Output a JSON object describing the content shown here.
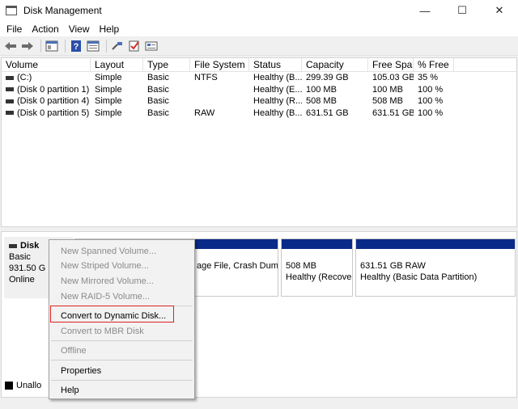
{
  "window": {
    "title": "Disk Management"
  },
  "window_buttons": {
    "minimize": "—",
    "maximize": "☐",
    "close": "✕"
  },
  "menubar": [
    "File",
    "Action",
    "View",
    "Help"
  ],
  "toolbar_icons": [
    "back-icon",
    "forward-icon",
    "show-hide-pane-icon",
    "help-icon",
    "properties-icon",
    "connect-icon",
    "check-icon",
    "settings-icon"
  ],
  "volumes": {
    "columns": [
      "Volume",
      "Layout",
      "Type",
      "File System",
      "Status",
      "Capacity",
      "Free Spa...",
      "% Free"
    ],
    "rows": [
      [
        "(C:)",
        "Simple",
        "Basic",
        "NTFS",
        "Healthy (B...",
        "299.39 GB",
        "105.03 GB",
        "35 %"
      ],
      [
        "(Disk 0 partition 1)",
        "Simple",
        "Basic",
        "",
        "Healthy (E...",
        "100 MB",
        "100 MB",
        "100 %"
      ],
      [
        "(Disk 0 partition 4)",
        "Simple",
        "Basic",
        "",
        "Healthy (R...",
        "508 MB",
        "508 MB",
        "100 %"
      ],
      [
        "(Disk 0 partition 5)",
        "Simple",
        "Basic",
        "RAW",
        "Healthy (B...",
        "631.51 GB",
        "631.51 GB",
        "100 %"
      ]
    ]
  },
  "disk": {
    "name": "Disk",
    "type": "Basic",
    "size": "931.50 G",
    "status": "Online",
    "partitions": [
      {
        "line1": "",
        "line2": "age File, Crash Dump,"
      },
      {
        "line1": "508 MB",
        "line2": "Healthy (Recoven"
      },
      {
        "line1": "631.51 GB RAW",
        "line2": "Healthy (Basic Data Partition)"
      }
    ]
  },
  "legend": {
    "unallocated": "Unallo"
  },
  "context_menu": {
    "items": [
      {
        "label": "New Spanned Volume...",
        "disabled": true
      },
      {
        "label": "New Striped Volume...",
        "disabled": true
      },
      {
        "label": "New Mirrored Volume...",
        "disabled": true
      },
      {
        "label": "New RAID-5 Volume...",
        "disabled": true
      },
      {
        "label": "Convert to Dynamic Disk...",
        "disabled": false
      },
      {
        "label": "Convert to MBR Disk",
        "disabled": true
      },
      {
        "label": "Offline",
        "disabled": true
      },
      {
        "label": "Properties",
        "disabled": false
      },
      {
        "label": "Help",
        "disabled": false
      }
    ]
  },
  "colors": {
    "partition_bar": "#0a2a8a",
    "highlight": "#e02020"
  }
}
